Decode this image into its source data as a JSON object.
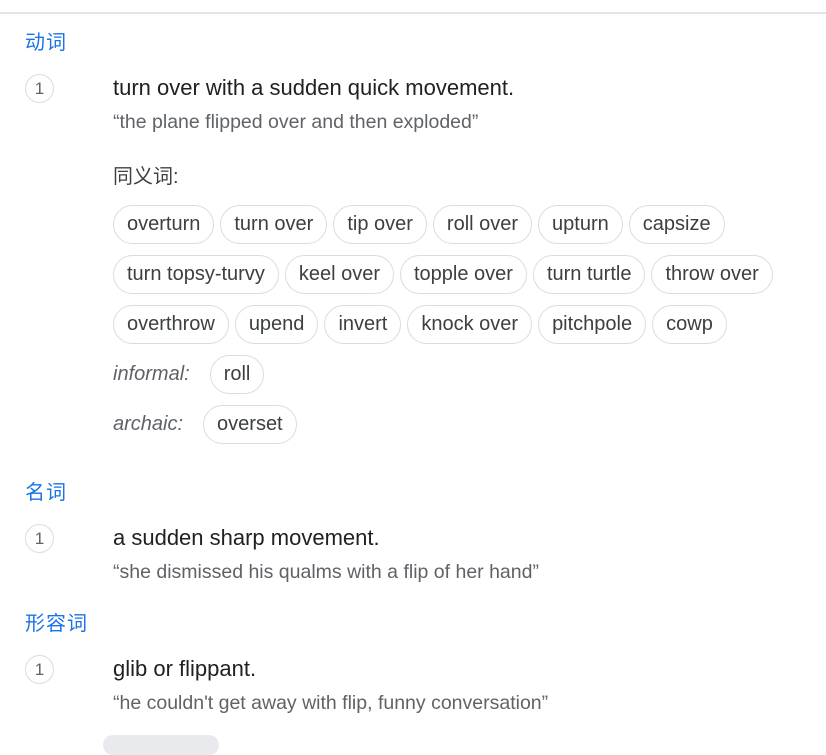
{
  "verb": {
    "pos_label": "动词",
    "sense1": {
      "number": "1",
      "definition": "turn over with a sudden quick movement.",
      "example": "“the plane flipped over and then exploded”",
      "synonyms_label": "同义词:",
      "synonyms": [
        "overturn",
        "turn over",
        "tip over",
        "roll over",
        "upturn",
        "capsize",
        "turn topsy-turvy",
        "keel over",
        "topple over",
        "turn turtle",
        "throw over",
        "overthrow",
        "upend",
        "invert",
        "knock over",
        "pitchpole",
        "cowp"
      ],
      "informal_label": "informal:",
      "informal": [
        "roll"
      ],
      "archaic_label": "archaic:",
      "archaic": [
        "overset"
      ]
    }
  },
  "noun": {
    "pos_label": "名词",
    "sense1": {
      "number": "1",
      "definition": "a sudden sharp movement.",
      "example": "“she dismissed his qualms with a flip of her hand”"
    }
  },
  "adjective": {
    "pos_label": "形容词",
    "sense1": {
      "number": "1",
      "definition": "glib or flippant.",
      "example": "“he couldn't get away with flip, funny conversation”"
    }
  }
}
